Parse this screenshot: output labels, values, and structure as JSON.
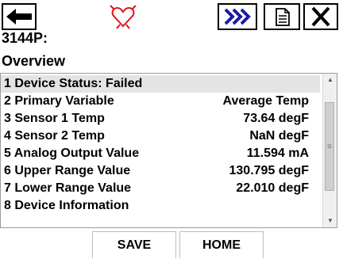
{
  "header": {
    "device_tag": "3144P:",
    "section_title": "Overview",
    "icons": {
      "back": "back-arrow-icon",
      "status": "heartbeat-heart-icon",
      "forward": "double-chevron-right-icon",
      "document": "document-icon",
      "close": "close-x-icon"
    }
  },
  "menu": {
    "items": [
      {
        "label": "1 Device Status: Failed",
        "value": ""
      },
      {
        "label": "2 Primary Variable",
        "value": "Average Temp"
      },
      {
        "label": "3 Sensor 1 Temp",
        "value": "73.64 degF"
      },
      {
        "label": "4 Sensor 2 Temp",
        "value": "NaN degF"
      },
      {
        "label": "5 Analog Output Value",
        "value": "11.594 mA"
      },
      {
        "label": "6 Upper Range Value",
        "value": "130.795 degF"
      },
      {
        "label": "7 Lower Range Value",
        "value": "22.010 degF"
      },
      {
        "label": "8 Device Information",
        "value": ""
      }
    ]
  },
  "footer": {
    "save_label": "SAVE",
    "home_label": "HOME"
  },
  "colors": {
    "heart_icon": "#e0121b",
    "forward_icon": "#1a1aa8",
    "selected_row": "#e4e4e4"
  }
}
